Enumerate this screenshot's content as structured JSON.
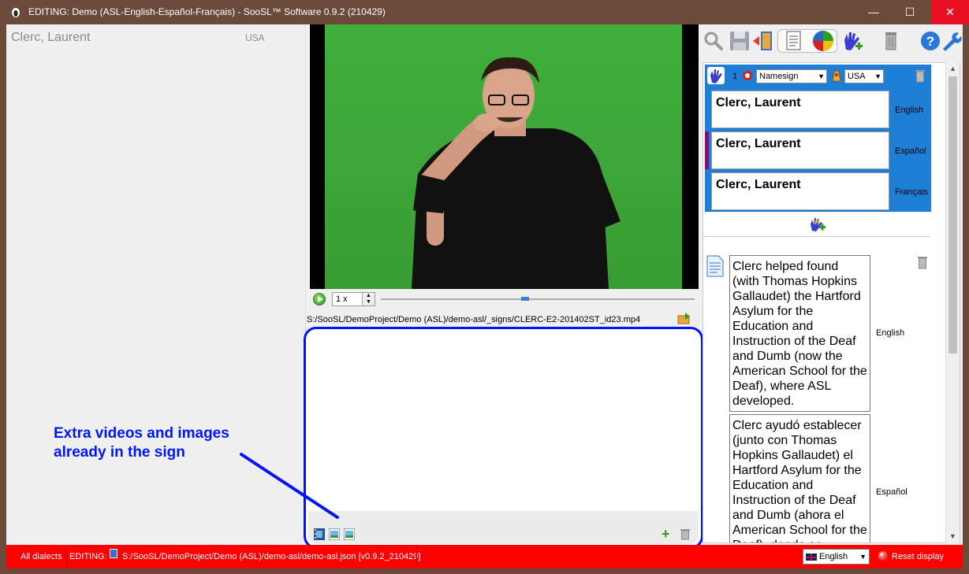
{
  "window": {
    "title": "EDITING: Demo (ASL-English-Español-Français) - SooSL™ Software 0.9.2 (210429)",
    "minimize": "—",
    "maximize": "☐",
    "close": "✕"
  },
  "left_list": {
    "items": [
      {
        "gloss": "Clerc, Laurent",
        "dialect": "USA"
      }
    ]
  },
  "player": {
    "speed": "1 x",
    "progress": 0.46,
    "file_path": "S:/SooSL/DemoProject/Demo (ASL)/demo-asl/_signs/CLERC-E2-201402ST_id23.mp4"
  },
  "media_panel": {
    "add_label": "+"
  },
  "annotation": {
    "text_line1": "Extra videos and images",
    "text_line2": "already in the sign"
  },
  "toolbar": {
    "icons": [
      "search-icon",
      "save-icon",
      "exit-icon",
      "notes-icon",
      "dialect-colors-icon",
      "add-sign-icon",
      "delete-icon",
      "help-icon",
      "settings-icon"
    ]
  },
  "sense": {
    "number": "1",
    "type": "Namesign",
    "dialect": "USA",
    "glosses": [
      {
        "text": "Clerc, Laurent",
        "language": "English"
      },
      {
        "text": "Clerc, Laurent",
        "language": "Español"
      },
      {
        "text": "Clerc, Laurent",
        "language": "Français"
      }
    ]
  },
  "extended_texts": [
    {
      "text": "Clerc helped found (with Thomas Hopkins Gallaudet) the Hartford Asylum for the Education and Instruction of the Deaf and Dumb (now the American School for the Deaf), where ASL developed.",
      "language": "English"
    },
    {
      "text": "Clerc ayudó establecer (junto con Thomas Hopkins Gallaudet) el Hartford Asylum for the Education and Instruction of the Deaf and Dumb (ahora el American School for the Deaf), donde se desarrolló la ASL.",
      "language": "Español"
    }
  ],
  "statusbar": {
    "dialects": "All dialects",
    "editing_label": "EDITING:",
    "project_path": "S:/SooSL/DemoProject/Demo (ASL)/demo-asl/demo-asl.json [v0.9.2_210429]",
    "language": "English",
    "reset": "Reset display"
  },
  "colors": {
    "accent_blue": "#1e7fd6",
    "annotation_blue": "#0015ff",
    "status_red": "#ff0000",
    "title_brown": "#6b4a3a"
  }
}
